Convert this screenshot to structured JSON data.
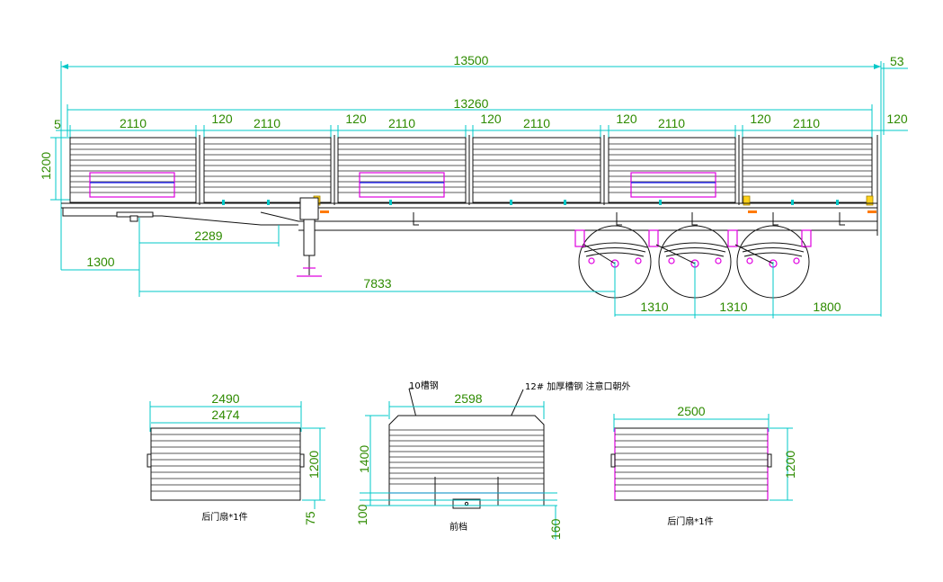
{
  "side_view": {
    "overall_length": "13500",
    "end_offset": "53",
    "body_length": "13260",
    "front_gap": "5",
    "panel_height": "1200",
    "panel_widths": [
      "2110",
      "2110",
      "2110",
      "2110",
      "2110",
      "2110"
    ],
    "panel_gaps": [
      "120",
      "120",
      "120",
      "120",
      "120",
      "120"
    ],
    "kingpin_to_leg": "2289",
    "front_to_kingpin": "1300",
    "kingpin_to_axle": "7833",
    "axle_spacing_1": "1310",
    "axle_spacing_2": "1310",
    "rear_overhang": "1800"
  },
  "rear_door": {
    "outer_width": "2490",
    "inner_width": "2474",
    "height": "1200",
    "bottom_gap": "75",
    "caption": "后门扇*1件"
  },
  "front_wall": {
    "width": "2598",
    "height": "1400",
    "bottom_offset": "100",
    "lower_offset": "160",
    "note_left": "10槽钢",
    "note_right": "12# 加厚槽钢  注意口朝外",
    "caption": "前档"
  },
  "side_door": {
    "width": "2500",
    "height": "1200",
    "caption": "后门扇*1件"
  },
  "colors": {
    "dimension": "#00c8c8",
    "dimension_text": "#2e8b00",
    "outline": "#111111",
    "highlight": "#e000e0",
    "blue": "#1a1aff"
  }
}
